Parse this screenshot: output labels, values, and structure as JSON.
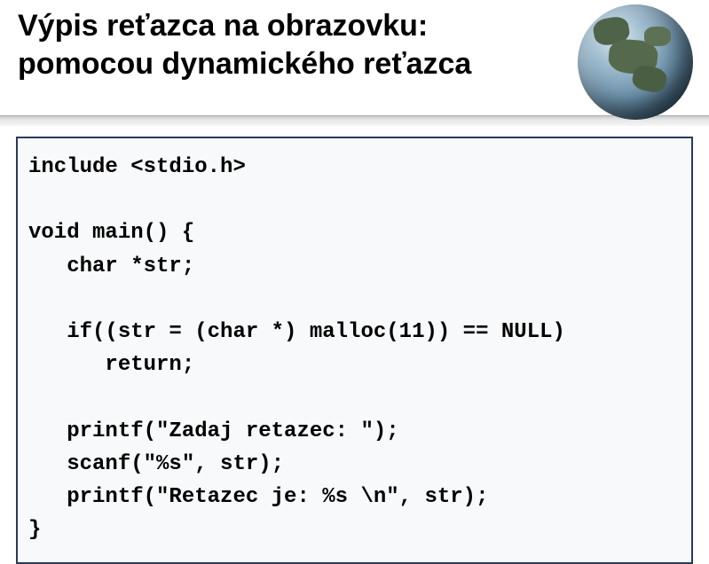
{
  "title_line1": "Výpis reťazca na obrazovku:",
  "title_line2": "pomocou dynamického reťazca",
  "code": {
    "l1": "include <stdio.h>",
    "l2": "",
    "l3": "void main() {",
    "l4": "   char *str;",
    "l5": "",
    "l6": "   if((str = (char *) malloc(11)) == NULL)",
    "l7": "      return;",
    "l8": "",
    "l9": "   printf(\"Zadaj retazec: \");",
    "l10": "   scanf(\"%s\", str);",
    "l11": "   printf(\"Retazec je: %s \\n\", str);",
    "l12": "}"
  }
}
